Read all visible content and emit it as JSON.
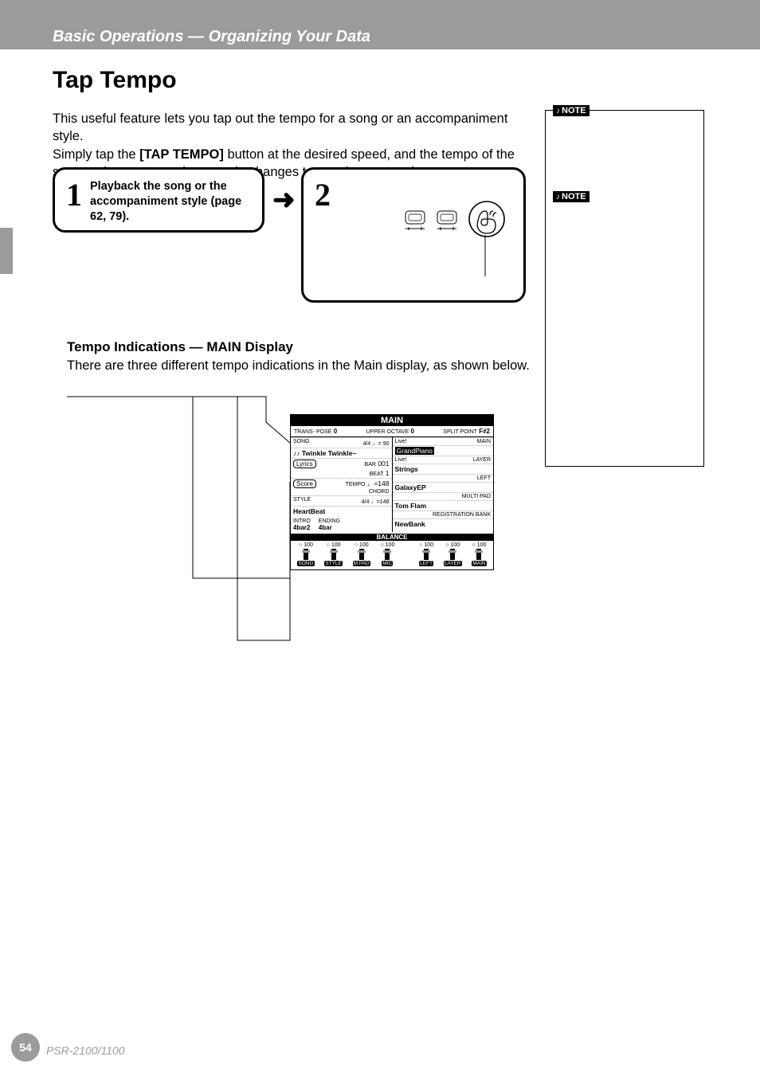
{
  "header": {
    "breadcrumb": "Basic Operations — Organizing Your Data"
  },
  "section": {
    "title": "Tap Tempo"
  },
  "intro": {
    "line1": "This useful feature lets you tap out the tempo for a song or an accompaniment style.",
    "line2a": "Simply tap the ",
    "button_name": "[TAP TEMPO]",
    "line2b": " button at the desired speed, and the tempo of the song or the accompaniment style changes to match your tapping."
  },
  "step1": {
    "num": "1",
    "text": "Playback the song or the accompaniment style (page 62, 79)."
  },
  "step2": {
    "num": "2"
  },
  "note_labels": {
    "note": "NOTE"
  },
  "subsection": {
    "heading": "Tempo Indications — MAIN Display",
    "body": "There are three different tempo indications in the Main display, as shown below."
  },
  "screenshot": {
    "title": "MAIN",
    "topbar": {
      "transpose_label": "TRANS- POSE",
      "transpose_val": "0",
      "upper_octave_label": "UPPER OCTAVE",
      "upper_octave_val": "0",
      "split_label": "SPLIT POINT",
      "split_val": "F#2"
    },
    "left": {
      "song_label": "SONG",
      "song_time": "4/4",
      "song_tempo": "♩= 90",
      "song_name": "♪♪ Twinkle Twinkle~",
      "lyrics_btn": "Lyrics",
      "bar_label": "BAR",
      "bar_val": "001",
      "beat_label": "BEAT",
      "beat_val": "1",
      "score_btn": "Score",
      "tempo_label": "TEMPO",
      "tempo_val": "♩=148",
      "chord_label": "CHORD",
      "style_label": "STYLE",
      "style_time": "4/4",
      "style_tempo": "♩=148",
      "style_name": "HeartBeat",
      "intro_label": "INTRO",
      "intro_val": "4bar2",
      "ending_label": "ENDING",
      "ending_val": "4bar"
    },
    "right": {
      "live_label": "Live!",
      "main_label": "MAIN",
      "main_voice": "GrandPiano",
      "layer_label": "LAYER",
      "layer_voice": "Strings",
      "left_label": "LEFT",
      "left_voice": "GalaxyEP",
      "multipad_label": "MULTI PAD",
      "multipad_name": "Tom Flam",
      "regbank_label": "REGISTRATION BANK",
      "regbank_name": "NewBank"
    },
    "balance_label": "BALANCE",
    "mixer": {
      "channels": [
        {
          "val": "100",
          "label": "SONG"
        },
        {
          "val": "100",
          "label": "STYLE"
        },
        {
          "val": "100",
          "label": "M.PAD"
        },
        {
          "val": "100",
          "label": "MIC"
        },
        {
          "val": "100",
          "label": "LEFT"
        },
        {
          "val": "100",
          "label": "LAYER"
        },
        {
          "val": "100",
          "label": "MAIN"
        }
      ]
    }
  },
  "footer": {
    "page_num": "54",
    "model": "PSR-2100/1100"
  }
}
